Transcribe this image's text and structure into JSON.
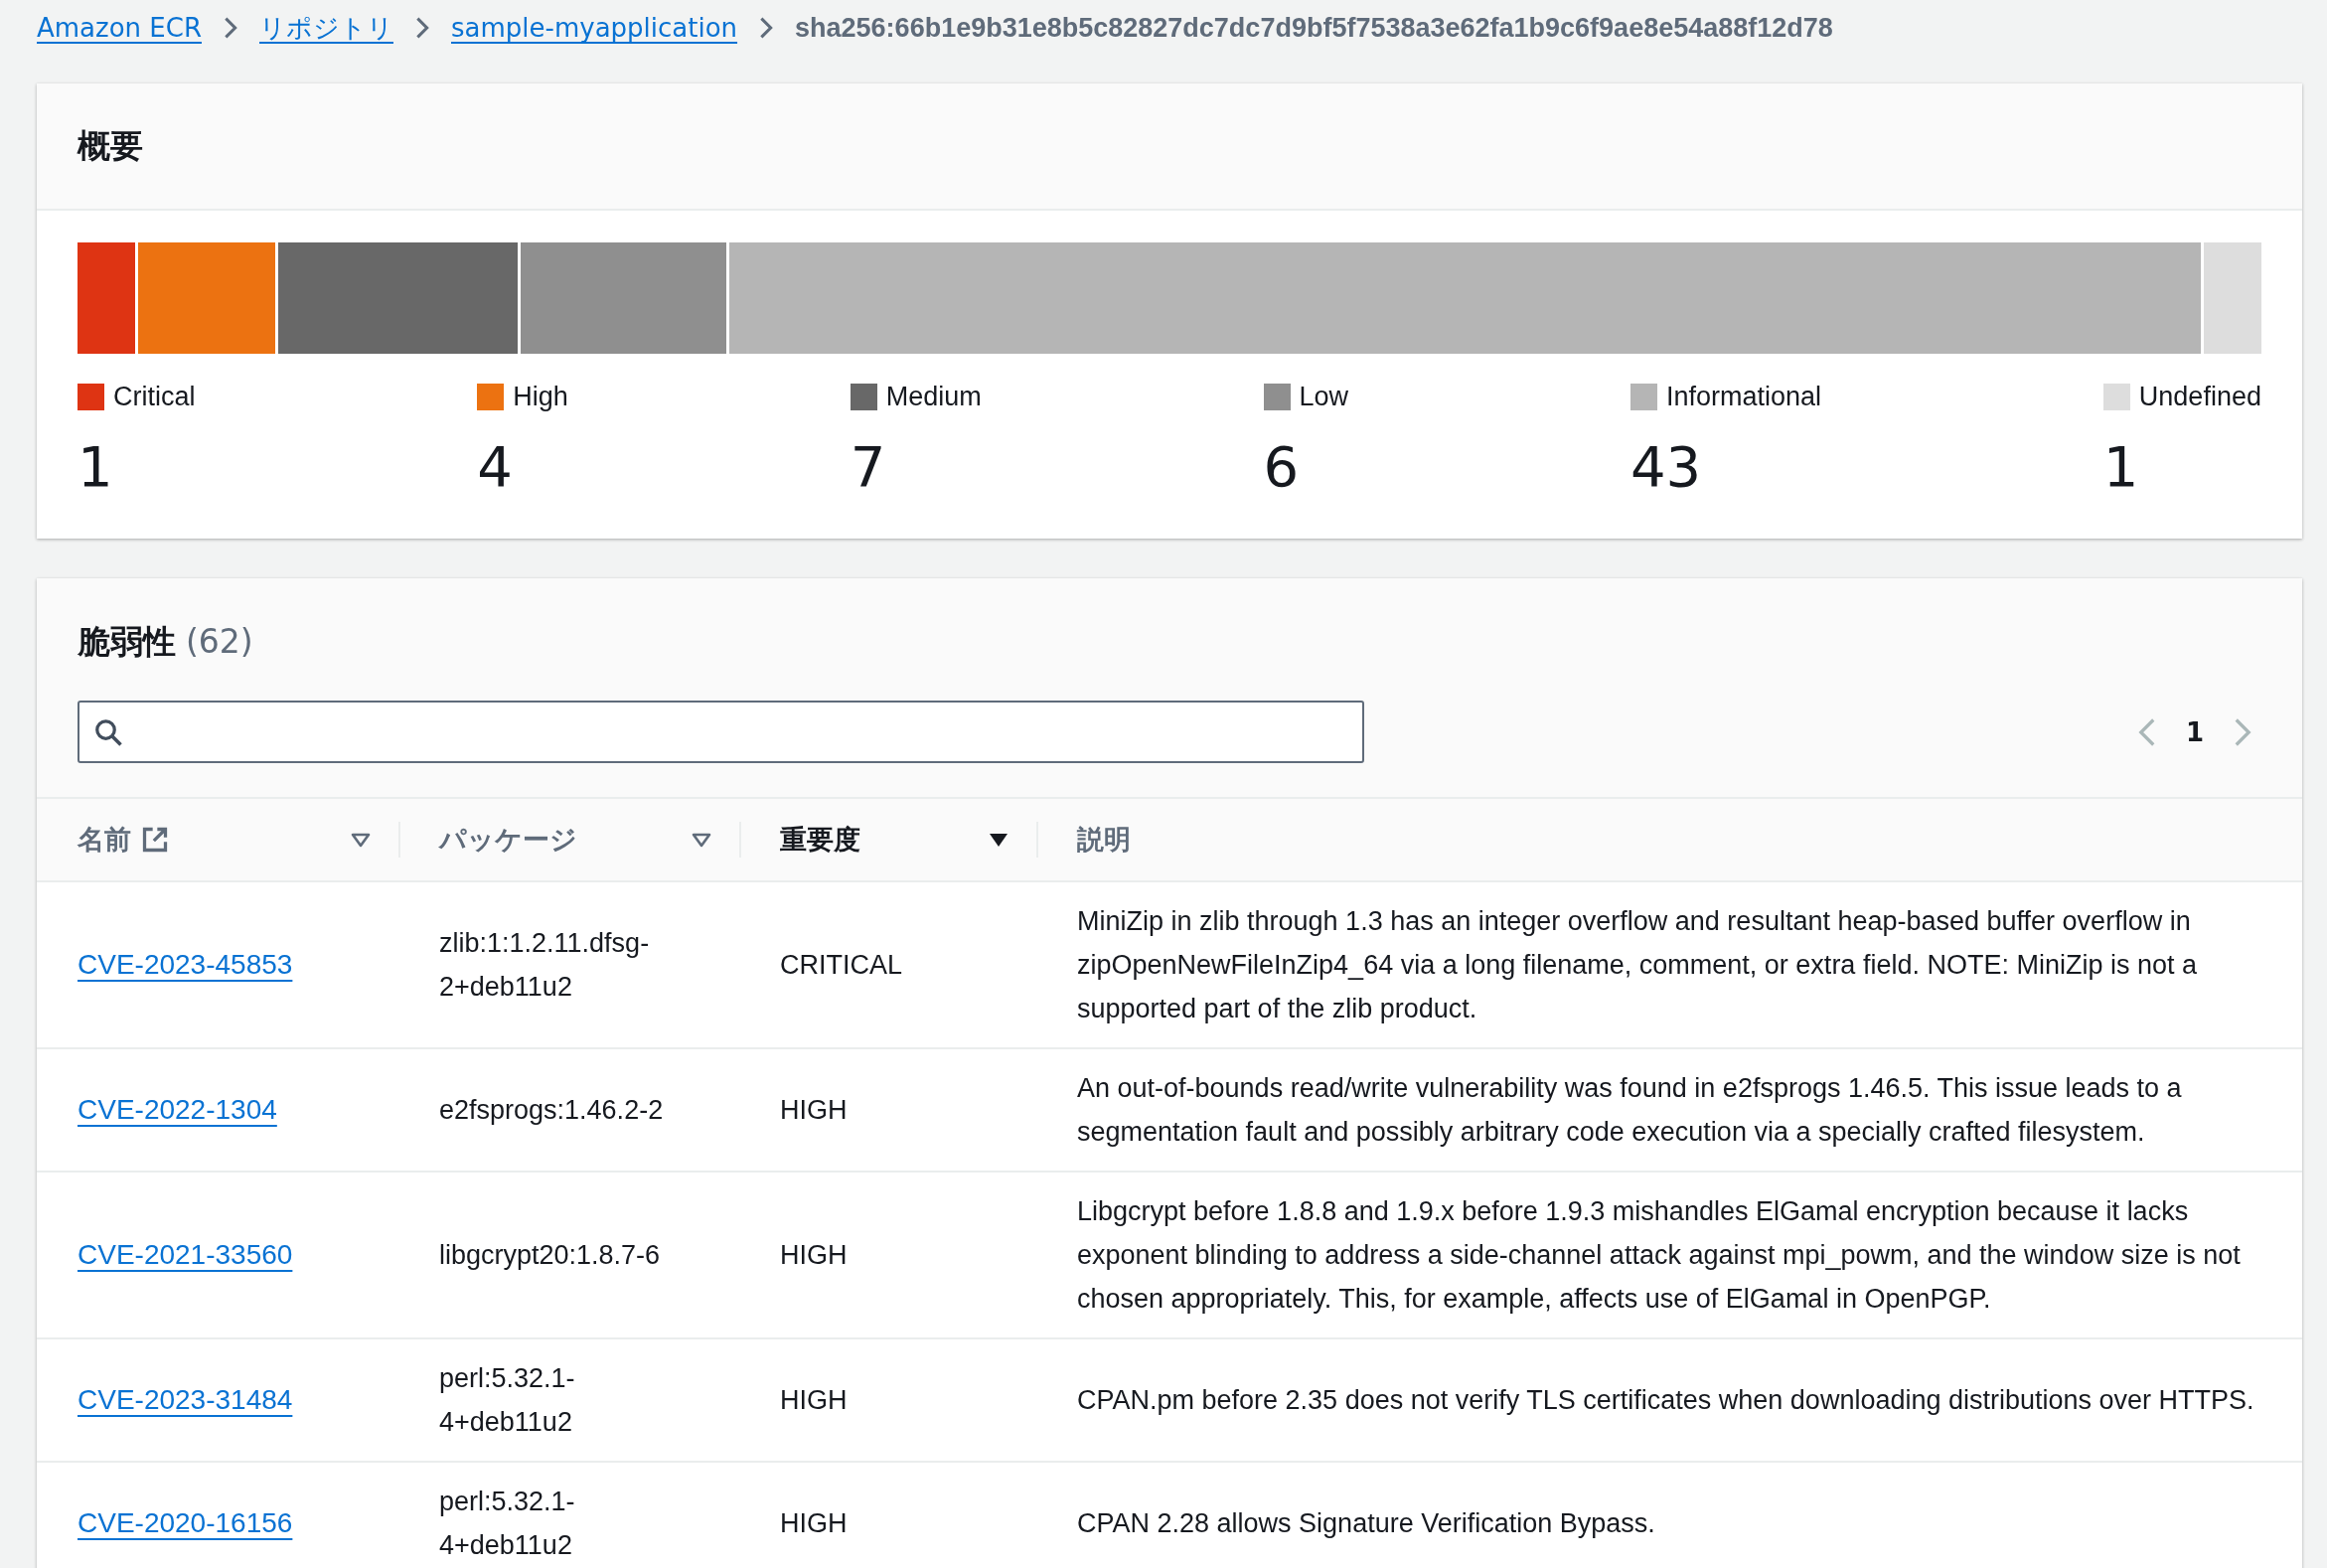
{
  "breadcrumbs": [
    {
      "label": "Amazon ECR",
      "link": true
    },
    {
      "label": "リポジトリ",
      "link": true
    },
    {
      "label": "sample-myapplication",
      "link": true
    },
    {
      "label": "sha256:66b1e9b31e8b5c82827dc7dc7d9bf5f7538a3e62fa1b9c6f9ae8e54a88f12d78",
      "link": false
    }
  ],
  "summary": {
    "title": "概要",
    "severities": [
      {
        "label": "Critical",
        "count": "1",
        "color": "#de3413"
      },
      {
        "label": "High",
        "count": "4",
        "color": "#ec7211"
      },
      {
        "label": "Medium",
        "count": "7",
        "color": "#686868"
      },
      {
        "label": "Low",
        "count": "6",
        "color": "#8f8f8f"
      },
      {
        "label": "Informational",
        "count": "43",
        "color": "#b5b5b5"
      },
      {
        "label": "Undefined",
        "count": "1",
        "color": "#dddddd"
      }
    ]
  },
  "vulnerabilities": {
    "title": "脆弱性",
    "count": "(62)",
    "pagination": {
      "page": "1"
    },
    "columns": [
      {
        "label": "名前",
        "sortable": true,
        "sorted": false,
        "external": true
      },
      {
        "label": "パッケージ",
        "sortable": true,
        "sorted": false,
        "external": false
      },
      {
        "label": "重要度",
        "sortable": true,
        "sorted": true,
        "external": false
      },
      {
        "label": "説明",
        "sortable": false,
        "sorted": false,
        "external": false
      }
    ],
    "rows": [
      {
        "name": "CVE-2023-45853",
        "package": "zlib:1:1.2.11.dfsg-2+deb11u2",
        "severity": "CRITICAL",
        "description": "MiniZip in zlib through 1.3 has an integer overflow and resultant heap-based buffer overflow in zipOpenNewFileInZip4_64 via a long filename, comment, or extra field. NOTE: MiniZip is not a supported part of the zlib product."
      },
      {
        "name": "CVE-2022-1304",
        "package": "e2fsprogs:1.46.2-2",
        "severity": "HIGH",
        "description": "An out-of-bounds read/write vulnerability was found in e2fsprogs 1.46.5. This issue leads to a segmentation fault and possibly arbitrary code execution via a specially crafted filesystem."
      },
      {
        "name": "CVE-2021-33560",
        "package": "libgcrypt20:1.8.7-6",
        "severity": "HIGH",
        "description": "Libgcrypt before 1.8.8 and 1.9.x before 1.9.3 mishandles ElGamal encryption because it lacks exponent blinding to address a side-channel attack against mpi_powm, and the window size is not chosen appropriately. This, for example, affects use of ElGamal in OpenPGP."
      },
      {
        "name": "CVE-2023-31484",
        "package": "perl:5.32.1-4+deb11u2",
        "severity": "HIGH",
        "description": "CPAN.pm before 2.35 does not verify TLS certificates when downloading distributions over HTTPS."
      },
      {
        "name": "CVE-2020-16156",
        "package": "perl:5.32.1-4+deb11u2",
        "severity": "HIGH",
        "description": "CPAN 2.28 allows Signature Verification Bypass."
      }
    ]
  }
}
